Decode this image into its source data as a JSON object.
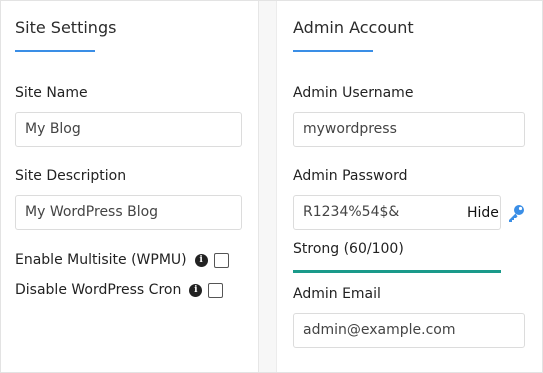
{
  "site_settings": {
    "title": "Site Settings",
    "site_name_label": "Site Name",
    "site_name_value": "My Blog",
    "site_description_label": "Site Description",
    "site_description_value": "My WordPress Blog",
    "multisite_label": "Enable Multisite (WPMU)",
    "multisite_checked": false,
    "cron_label": "Disable WordPress Cron",
    "cron_checked": false
  },
  "admin_account": {
    "title": "Admin Account",
    "username_label": "Admin Username",
    "username_value": "mywordpress",
    "password_label": "Admin Password",
    "password_value": "R1234%54$&",
    "hide_label": "Hide",
    "strength_text": "Strong (60/100)",
    "strength_value": 0.6,
    "email_label": "Admin Email",
    "email_value": "admin@example.com"
  },
  "colors": {
    "accent": "#3a8ee6",
    "strength_bar": "#1a9a8a",
    "key_icon": "#3a8ee6"
  }
}
